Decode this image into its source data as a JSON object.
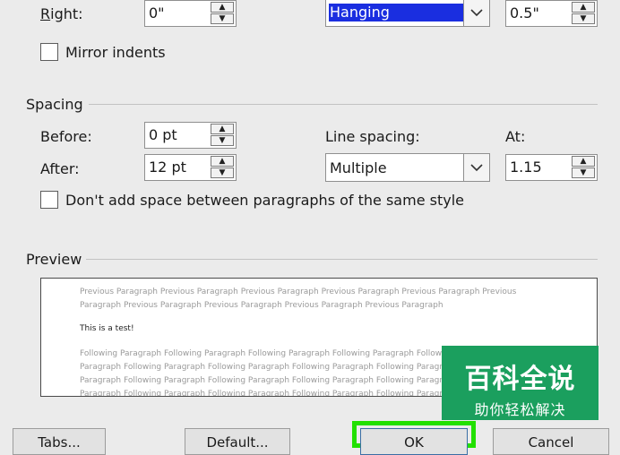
{
  "indentation": {
    "right_label": "Right:",
    "right_value": "0\"",
    "special_value": "Hanging",
    "by_value": "0.5\"",
    "mirror_label": "Mirror indents"
  },
  "spacing": {
    "section_title": "Spacing",
    "before_label": "Before:",
    "before_value": "0 pt",
    "after_label": "After:",
    "after_value": "12 pt",
    "line_spacing_label": "Line spacing:",
    "line_spacing_value": "Multiple",
    "at_label": "At:",
    "at_value": "1.15",
    "dont_add_space_label": "Don't add space between paragraphs of the same style"
  },
  "preview": {
    "section_title": "Preview",
    "previous_lines": [
      "Previous Paragraph Previous Paragraph Previous Paragraph Previous Paragraph Previous Paragraph Previous",
      "Paragraph Previous Paragraph Previous Paragraph Previous Paragraph Previous Paragraph"
    ],
    "sample_text": "This is a test!",
    "following_lines": [
      "Following Paragraph Following Paragraph Following Paragraph Following Paragraph Following Paragraph",
      "Paragraph Following Paragraph Following Paragraph Following Paragraph Following Paragraph Following",
      "Paragraph Following Paragraph Following Paragraph Following Paragraph Following Paragraph Following",
      "Paragraph Following Paragraph Following Paragraph Following Paragraph Following Paragraph Following"
    ]
  },
  "buttons": {
    "tabs": "Tabs...",
    "default": "Default...",
    "ok": "OK",
    "cancel": "Cancel"
  },
  "watermark": {
    "title": "百科全说",
    "subtitle": "助你轻松解决"
  },
  "colors": {
    "dialog_bg": "#ebebeb",
    "selection": "#1a2ee0",
    "ok_highlight": "#22e000",
    "watermark_bg": "#1b9f5e"
  }
}
